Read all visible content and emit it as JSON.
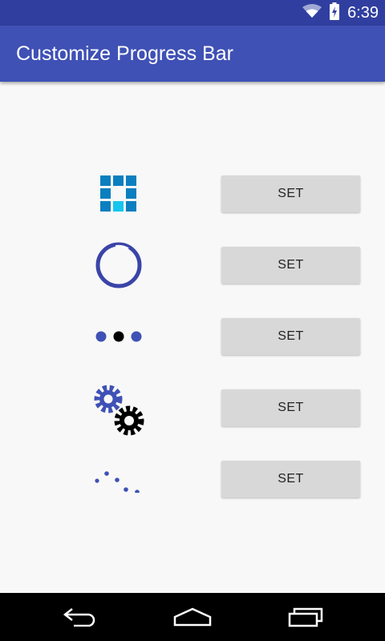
{
  "status_bar": {
    "time": "6:39",
    "icons": [
      "wifi-icon",
      "battery-charging-icon"
    ]
  },
  "app_bar": {
    "title": "Customize Progress Bar"
  },
  "rows": [
    {
      "indicator": "square-grid-loader",
      "button_label": "SET"
    },
    {
      "indicator": "circular-ring-loader",
      "button_label": "SET"
    },
    {
      "indicator": "three-dots-loader",
      "button_label": "SET"
    },
    {
      "indicator": "gears-loader",
      "button_label": "SET"
    },
    {
      "indicator": "scattered-dots-loader",
      "button_label": "SET"
    }
  ],
  "nav_bar": {
    "icons": [
      "back-icon",
      "home-icon",
      "recents-icon"
    ]
  },
  "colors": {
    "status_bar": "#303f9f",
    "app_bar": "#3f51b5",
    "indicator_blue": "#3f51b5",
    "grid_blue": "#0b7fbf",
    "grid_cyan": "#16c6ee",
    "button": "#d8d8d8"
  }
}
